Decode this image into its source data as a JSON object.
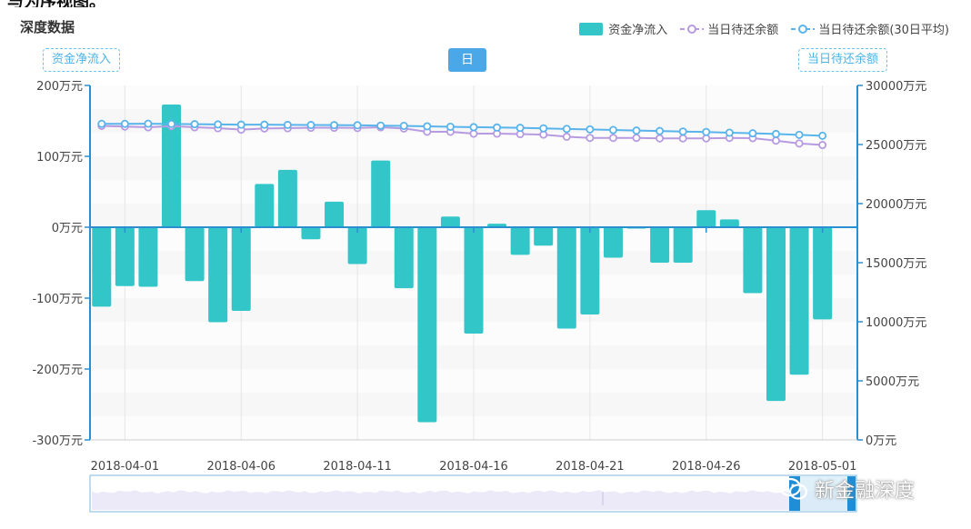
{
  "top_text": "与为序视图。",
  "title": "深度数据",
  "legend": {
    "bar_label": "资金净流入",
    "line1_label": "当日待还余额",
    "line2_label": "当日待还余额(30日平均)"
  },
  "left_pill": "资金净流入",
  "day_button": "日",
  "right_pill": "当日待还余额",
  "watermark": "新金融深度",
  "colors": {
    "bar": "#33c6c8",
    "line1": "#b79be0",
    "line2": "#5ab4ec",
    "axis": "#2a8fd0"
  },
  "chart_data": {
    "type": "bar",
    "title": "深度数据",
    "legend_position": "top-right",
    "x_tick_labels": [
      "2018-04-01",
      "2018-04-06",
      "2018-04-11",
      "2018-04-16",
      "2018-04-21",
      "2018-04-26",
      "2018-05-01"
    ],
    "y_left": {
      "unit": "万元",
      "range": [
        -300,
        200
      ],
      "ticks": [
        200,
        100,
        0,
        -100,
        -200,
        -300
      ],
      "tick_labels": [
        "200万元",
        "100万元",
        "0万元",
        "-100万元",
        "-200万元",
        "-300万元"
      ]
    },
    "y_right": {
      "unit": "万元",
      "range": [
        0,
        30000
      ],
      "ticks": [
        30000,
        25000,
        20000,
        15000,
        10000,
        5000,
        0
      ],
      "tick_labels": [
        "30000万元",
        "25000万元",
        "20000万元",
        "15000万元",
        "10000万元",
        "5000万元",
        "0万元"
      ]
    },
    "categories": [
      "2018-03-31",
      "2018-04-01",
      "2018-04-02",
      "2018-04-03",
      "2018-04-04",
      "2018-04-05",
      "2018-04-06",
      "2018-04-07",
      "2018-04-08",
      "2018-04-09",
      "2018-04-10",
      "2018-04-11",
      "2018-04-12",
      "2018-04-13",
      "2018-04-14",
      "2018-04-15",
      "2018-04-16",
      "2018-04-17",
      "2018-04-18",
      "2018-04-19",
      "2018-04-20",
      "2018-04-21",
      "2018-04-22",
      "2018-04-23",
      "2018-04-24",
      "2018-04-25",
      "2018-04-26",
      "2018-04-27",
      "2018-04-28",
      "2018-04-29",
      "2018-04-30",
      "2018-05-01",
      "2018-05-02"
    ],
    "series": [
      {
        "name": "资金净流入",
        "type": "bar",
        "axis": "left",
        "values": [
          -112,
          -83,
          -84,
          173,
          -76,
          -134,
          -118,
          61,
          81,
          -17,
          36,
          -52,
          94,
          -86,
          -275,
          15,
          -150,
          5,
          -39,
          -26,
          -143,
          -123,
          -43,
          -2,
          -50,
          -50,
          24,
          11,
          -93,
          -245,
          -208,
          -130
        ]
      },
      {
        "name": "当日待还余额",
        "type": "line",
        "axis": "right",
        "values": [
          26580,
          26520,
          26460,
          26560,
          26460,
          26380,
          26260,
          26360,
          26380,
          26420,
          26420,
          26400,
          26460,
          26360,
          26080,
          26080,
          25920,
          25920,
          25880,
          25840,
          25660,
          25560,
          25560,
          25560,
          25520,
          25520,
          25520,
          25560,
          25540,
          25330,
          25090,
          24960
        ]
      },
      {
        "name": "当日待还余额(30日平均)",
        "type": "line",
        "axis": "right",
        "values": [
          26750,
          26750,
          26760,
          26740,
          26720,
          26700,
          26680,
          26680,
          26660,
          26650,
          26640,
          26630,
          26600,
          26580,
          26540,
          26500,
          26470,
          26440,
          26410,
          26370,
          26320,
          26280,
          26230,
          26180,
          26140,
          26100,
          26060,
          26000,
          25950,
          25890,
          25820,
          25740
        ]
      }
    ]
  }
}
